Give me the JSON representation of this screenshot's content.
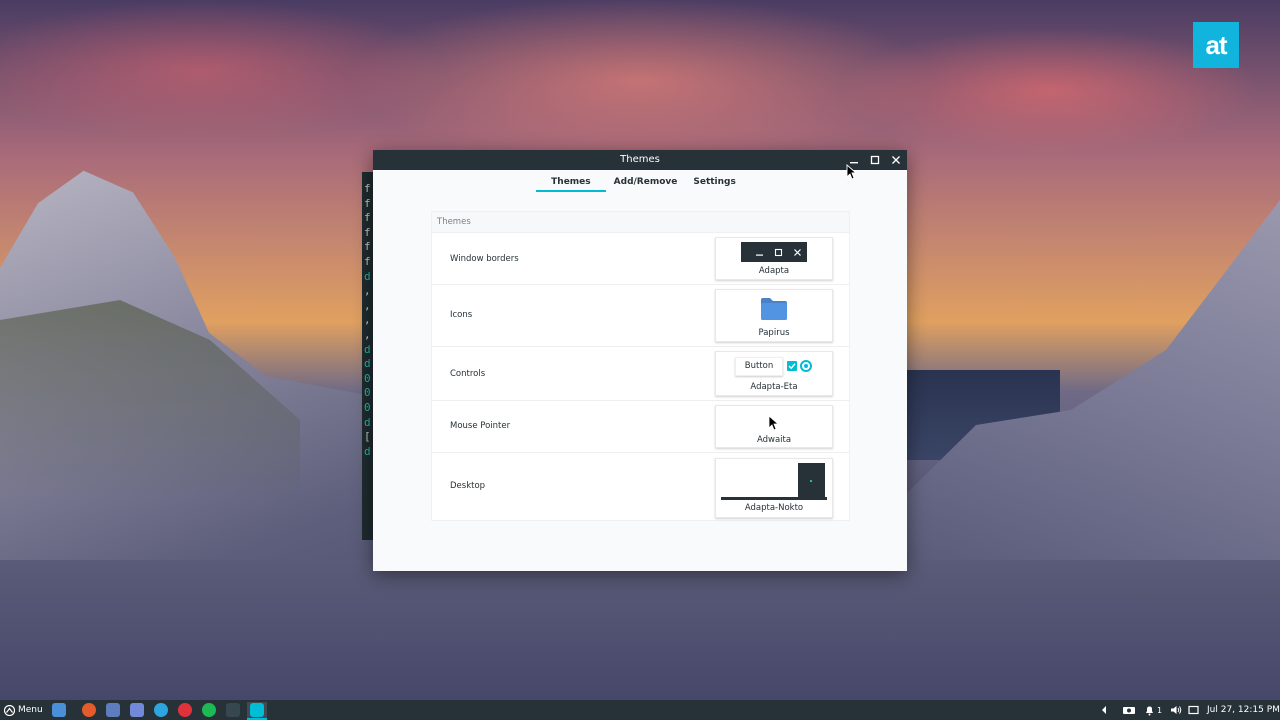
{
  "desktop": {
    "logo_text": "at"
  },
  "terminal": {
    "lines": [
      "f",
      "f",
      "f",
      "f",
      "f",
      "f",
      "d",
      ",",
      ",",
      ",",
      ",",
      "d",
      "d",
      "0",
      "0",
      "0",
      "d",
      "[",
      "d"
    ]
  },
  "window": {
    "title": "Themes",
    "controls": {
      "minimize_icon": "minimize-icon",
      "maximize_icon": "maximize-icon",
      "close_icon": "close-icon"
    },
    "tabs": [
      {
        "label": "Themes",
        "active": true
      },
      {
        "label": "Add/Remove",
        "active": false
      },
      {
        "label": "Settings",
        "active": false
      }
    ],
    "section_heading": "Themes",
    "rows": {
      "window_borders": {
        "label": "Window borders",
        "value": "Adapta"
      },
      "icons": {
        "label": "Icons",
        "value": "Papirus"
      },
      "controls": {
        "label": "Controls",
        "value": "Adapta-Eta",
        "button_preview": "Button"
      },
      "mouse_pointer": {
        "label": "Mouse Pointer",
        "value": "Adwaita"
      },
      "desktop": {
        "label": "Desktop",
        "value": "Adapta-Nokto"
      }
    }
  },
  "taskbar": {
    "menu_label": "Menu",
    "apps": [
      {
        "icon": "files-icon",
        "color": "#4a90d9"
      },
      {
        "icon": "firefox-icon",
        "color": "#e55b2b"
      },
      {
        "icon": "network-icon",
        "color": "#5e7dbf"
      },
      {
        "icon": "discord-icon",
        "color": "#7289da"
      },
      {
        "icon": "telegram-icon",
        "color": "#2ca5e0"
      },
      {
        "icon": "vivaldi-icon",
        "color": "#e0323a"
      },
      {
        "icon": "spotify-icon",
        "color": "#1db954"
      },
      {
        "icon": "terminal-icon",
        "color": "#37474f"
      },
      {
        "icon": "themes-icon",
        "color": "#00bcd4"
      }
    ],
    "tray": {
      "notification_count": "1",
      "clock": "Jul 27, 12:15 PM"
    }
  },
  "colors": {
    "accent": "#00bcd4",
    "titlebar": "#263238",
    "folder": "#5294e2"
  }
}
